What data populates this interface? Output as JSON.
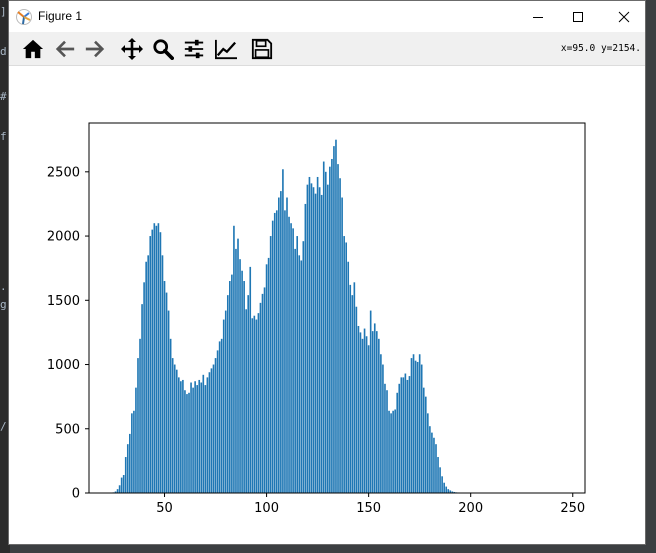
{
  "window": {
    "title": "Figure 1",
    "minimize_label": "Minimize",
    "maximize_label": "Maximize",
    "close_label": "Close"
  },
  "toolbar": {
    "buttons": [
      {
        "name": "home",
        "icon": "home-icon"
      },
      {
        "name": "back",
        "icon": "arrow-left-icon"
      },
      {
        "name": "forward",
        "icon": "arrow-right-icon"
      },
      {
        "name": "pan",
        "icon": "move-icon"
      },
      {
        "name": "zoom",
        "icon": "magnifier-icon"
      },
      {
        "name": "configure-subplots",
        "icon": "sliders-icon"
      },
      {
        "name": "edit-axis",
        "icon": "line-chart-icon"
      },
      {
        "name": "save",
        "icon": "floppy-disk-icon"
      }
    ],
    "coordinates": "x=95.0 y=2154."
  },
  "colors": {
    "bar": "#1f77b4",
    "toolbar_bg": "#f0f0f0",
    "ide_bg": "#3c3f41"
  },
  "chart_data": {
    "type": "bar",
    "title": "",
    "xlabel": "",
    "ylabel": "",
    "xlim": [
      13,
      256
    ],
    "ylim": [
      0,
      2880
    ],
    "xticks": [
      50,
      100,
      150,
      200,
      250
    ],
    "yticks": [
      0,
      500,
      1000,
      1500,
      2000,
      2500
    ],
    "grid": false,
    "legend": "none",
    "bar_width": 0.8,
    "x": [
      25,
      26,
      27,
      28,
      29,
      30,
      31,
      32,
      33,
      34,
      35,
      36,
      37,
      38,
      39,
      40,
      41,
      42,
      43,
      44,
      45,
      46,
      47,
      48,
      49,
      50,
      51,
      52,
      53,
      54,
      55,
      56,
      57,
      58,
      59,
      60,
      61,
      62,
      63,
      64,
      65,
      66,
      67,
      68,
      69,
      70,
      71,
      72,
      73,
      74,
      75,
      76,
      77,
      78,
      79,
      80,
      81,
      82,
      83,
      84,
      85,
      86,
      87,
      88,
      89,
      90,
      91,
      92,
      93,
      94,
      95,
      96,
      97,
      98,
      99,
      100,
      101,
      102,
      103,
      104,
      105,
      106,
      107,
      108,
      109,
      110,
      111,
      112,
      113,
      114,
      115,
      116,
      117,
      118,
      119,
      120,
      121,
      122,
      123,
      124,
      125,
      126,
      127,
      128,
      129,
      130,
      131,
      132,
      133,
      134,
      135,
      136,
      137,
      138,
      139,
      140,
      141,
      142,
      143,
      144,
      145,
      146,
      147,
      148,
      149,
      150,
      151,
      152,
      153,
      154,
      155,
      156,
      157,
      158,
      159,
      160,
      161,
      162,
      163,
      164,
      165,
      166,
      167,
      168,
      169,
      170,
      171,
      172,
      173,
      174,
      175,
      176,
      177,
      178,
      179,
      180,
      181,
      182,
      183,
      184,
      185,
      186,
      187,
      188,
      189,
      190,
      191,
      192,
      193,
      194,
      195,
      196,
      197,
      198,
      199,
      200,
      201,
      202,
      203,
      204,
      205,
      206,
      207,
      208,
      209,
      210,
      211,
      212,
      213,
      214,
      215,
      216,
      217,
      218,
      219,
      220,
      221,
      222,
      223,
      224,
      225,
      226,
      227,
      228,
      229,
      230,
      231,
      232,
      233,
      234,
      235,
      236,
      237,
      238,
      239,
      240,
      241,
      242,
      243,
      244,
      245,
      246,
      247,
      248
    ],
    "values": [
      5,
      12,
      30,
      60,
      120,
      140,
      280,
      380,
      460,
      620,
      640,
      820,
      1050,
      1200,
      1470,
      1640,
      1800,
      1850,
      2000,
      2050,
      2100,
      2080,
      2100,
      2030,
      1850,
      1650,
      1560,
      1420,
      1200,
      1050,
      1000,
      960,
      900,
      870,
      880,
      800,
      770,
      780,
      860,
      820,
      870,
      840,
      880,
      860,
      920,
      840,
      900,
      940,
      970,
      1000,
      1050,
      1110,
      1180,
      1200,
      1350,
      1420,
      1540,
      1650,
      1700,
      2080,
      1900,
      1980,
      1820,
      1730,
      1650,
      1430,
      1540,
      1760,
      1360,
      1380,
      1350,
      1400,
      1480,
      1550,
      1600,
      1780,
      1830,
      2000,
      2120,
      2180,
      2200,
      2300,
      2350,
      2520,
      2200,
      2300,
      2150,
      2100,
      2060,
      1900,
      2000,
      1850,
      1810,
      1960,
      2250,
      2400,
      2460,
      2410,
      2380,
      2330,
      2460,
      2380,
      2320,
      2580,
      2500,
      2400,
      2540,
      2600,
      2700,
      2750,
      2560,
      2450,
      2300,
      2000,
      1950,
      1800,
      1620,
      1540,
      1640,
      1450,
      1300,
      1250,
      1200,
      1280,
      1220,
      1150,
      1420,
      1260,
      1320,
      1260,
      1200,
      1080,
      1000,
      850,
      800,
      640,
      620,
      640,
      650,
      780,
      850,
      900,
      900,
      930,
      880,
      910,
      1050,
      1080,
      1030,
      1020,
      1080,
      1000,
      820,
      750,
      620,
      520,
      470,
      430,
      380,
      280,
      200,
      130,
      80,
      50,
      30,
      20,
      12,
      8,
      5,
      4,
      3,
      2,
      1,
      1,
      1,
      1,
      1,
      1,
      1,
      1,
      1,
      1,
      1,
      1,
      1,
      1,
      1,
      1,
      1,
      1,
      1,
      1,
      1,
      1,
      1,
      1,
      1,
      1,
      1,
      1,
      1,
      1,
      1,
      1,
      1,
      1,
      1,
      1,
      1,
      1,
      1,
      1,
      1,
      1,
      1,
      1
    ]
  }
}
